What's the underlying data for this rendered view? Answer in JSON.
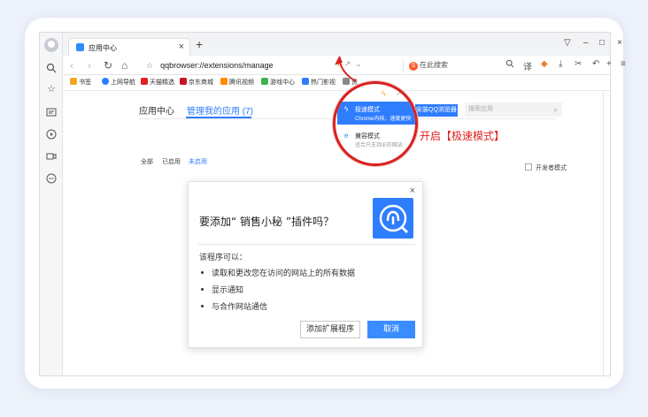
{
  "tab": {
    "title": "应用中心"
  },
  "address": {
    "url": "qqbrowser://extensions/manage"
  },
  "search": {
    "placeholder": "在此搜索"
  },
  "bookmarks": [
    {
      "label": "书签",
      "color": "#f5a623"
    },
    {
      "label": "上网导航",
      "color": "#2f7dff"
    },
    {
      "label": "天猫精选",
      "color": "#e02020"
    },
    {
      "label": "京东商城",
      "color": "#c81623"
    },
    {
      "label": "腾讯视频",
      "color": "#ff8a00"
    },
    {
      "label": "游戏中心",
      "color": "#3fb34f"
    },
    {
      "label": "热门影视",
      "color": "#2f7dff"
    },
    {
      "label": "资",
      "color": "#888888"
    }
  ],
  "page": {
    "tabs": [
      "应用中心",
      "管理我的应用 (7)"
    ],
    "filters": [
      "全部",
      "已启用",
      "未启用"
    ],
    "blue_button": "安装QQ浏览器",
    "search_placeholder": "搜索应用",
    "dev_mode": "开发者模式"
  },
  "mode_menu": {
    "fast_title": "极速模式",
    "fast_sub": "Chrome内核，速度更快",
    "compat_title": "兼容模式",
    "compat_sub": "适合只支持IE的网站"
  },
  "callout": "开启【极速模式】",
  "dialog": {
    "title": "要添加“ 销售小秘 ”插件吗？",
    "intro": "该程序可以：",
    "permissions": [
      "读取和更改您在访问的网站上的所有数据",
      "显示通知",
      "与合作网站通信"
    ],
    "add_button": "添加扩展程序",
    "cancel_button": "取消"
  },
  "colors": {
    "accent": "#2f7dff",
    "callout": "#e02020"
  }
}
